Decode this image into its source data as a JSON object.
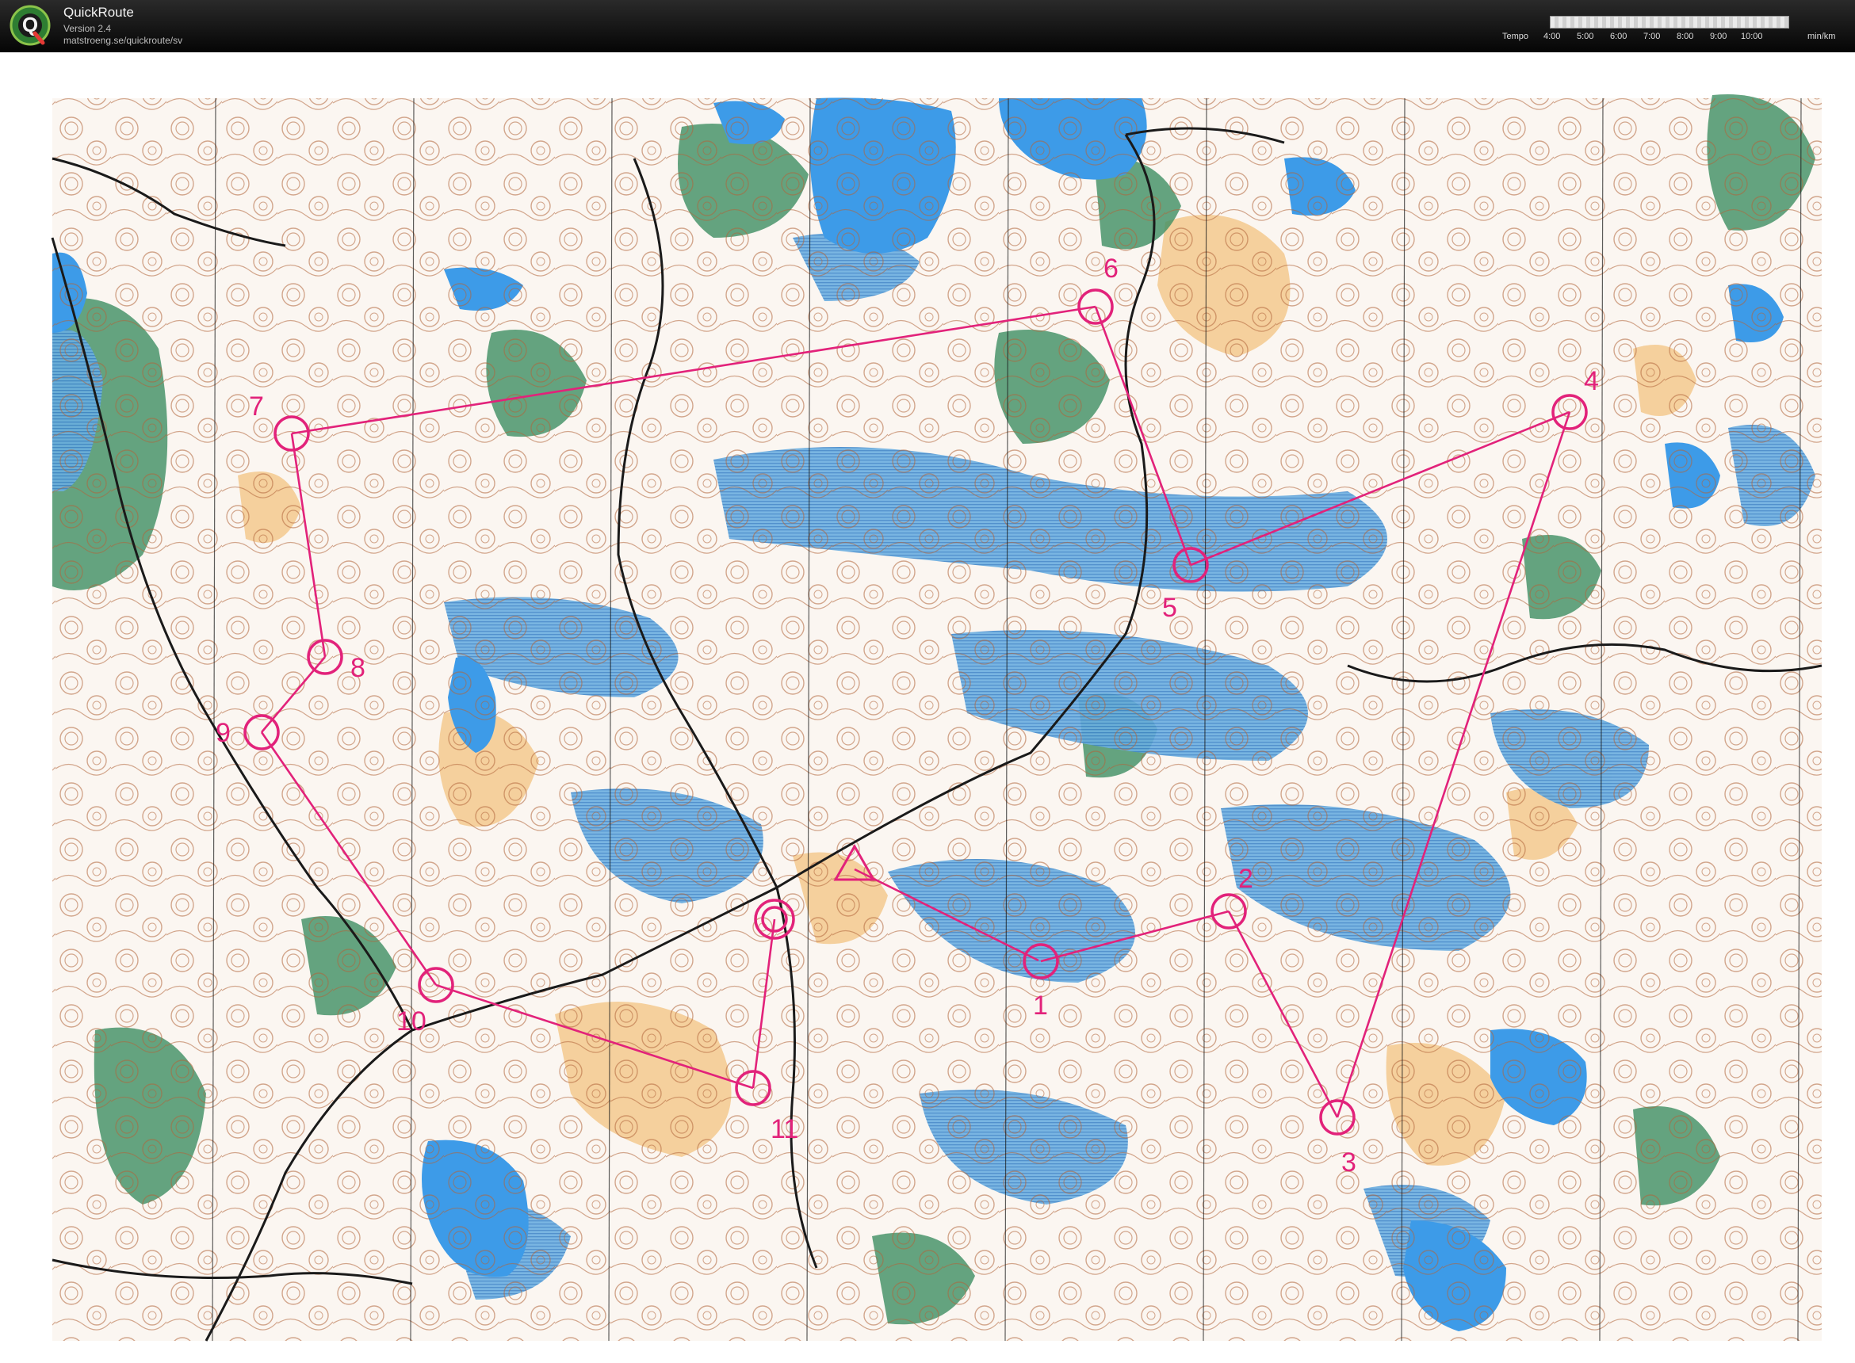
{
  "app": {
    "title": "QuickRoute",
    "version": "Version 2.4",
    "url": "matstroeng.se/quickroute/sv",
    "logo_letter": "Q"
  },
  "tempo": {
    "label": "Tempo",
    "ticks": [
      "4:00",
      "5:00",
      "6:00",
      "7:00",
      "8:00",
      "9:00",
      "10:00"
    ],
    "unit": "min/km"
  },
  "colors": {
    "course": "#e2227a",
    "water": "#4d9fe0",
    "forest": "#3f8f63",
    "open": "#f3c98e",
    "contour": "#a0522d",
    "road": "#1a1a1a"
  },
  "course": {
    "start_icon": "start-triangle-icon",
    "finish_icon": "finish-double-circle-icon",
    "controls": [
      {
        "number": "1"
      },
      {
        "number": "2"
      },
      {
        "number": "3"
      },
      {
        "number": "4"
      },
      {
        "number": "5"
      },
      {
        "number": "6"
      },
      {
        "number": "7"
      },
      {
        "number": "8"
      },
      {
        "number": "9"
      },
      {
        "number": "10"
      },
      {
        "number": "11"
      }
    ]
  }
}
